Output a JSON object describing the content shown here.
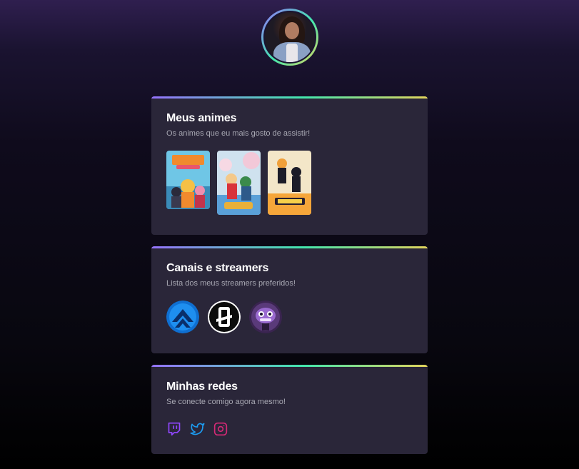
{
  "profile": {
    "avatar_alt": "profile photo"
  },
  "animes_card": {
    "title": "Meus animes",
    "subtitle": "Os animes que eu mais gosto de assistir!",
    "items": [
      {
        "name": "Naruto",
        "icon": "naruto-poster"
      },
      {
        "name": "One Piece",
        "icon": "one-piece-poster"
      },
      {
        "name": "Haikyuu!!",
        "icon": "haikyuu-poster"
      }
    ]
  },
  "streamers_card": {
    "title": "Canais e streamers",
    "subtitle": "Lista dos meus streamers preferidos!",
    "items": [
      {
        "icon": "blue-arrows-avatar"
      },
      {
        "icon": "black-white-logo-avatar"
      },
      {
        "icon": "purple-robot-avatar"
      }
    ]
  },
  "social_card": {
    "title": "Minhas redes",
    "subtitle": "Se conecte comigo agora mesmo!",
    "items": [
      {
        "name": "Twitch",
        "icon": "twitch-icon",
        "color": "#9147ff"
      },
      {
        "name": "Twitter",
        "icon": "twitter-icon",
        "color": "#1d9bf0"
      },
      {
        "name": "Instagram",
        "icon": "instagram-icon",
        "color": "#d62976"
      }
    ]
  },
  "colors": {
    "gradient_start": "#9572fc",
    "gradient_mid": "#43e7ad",
    "gradient_end": "#e2d45c",
    "card_bg": "#2a2639"
  }
}
